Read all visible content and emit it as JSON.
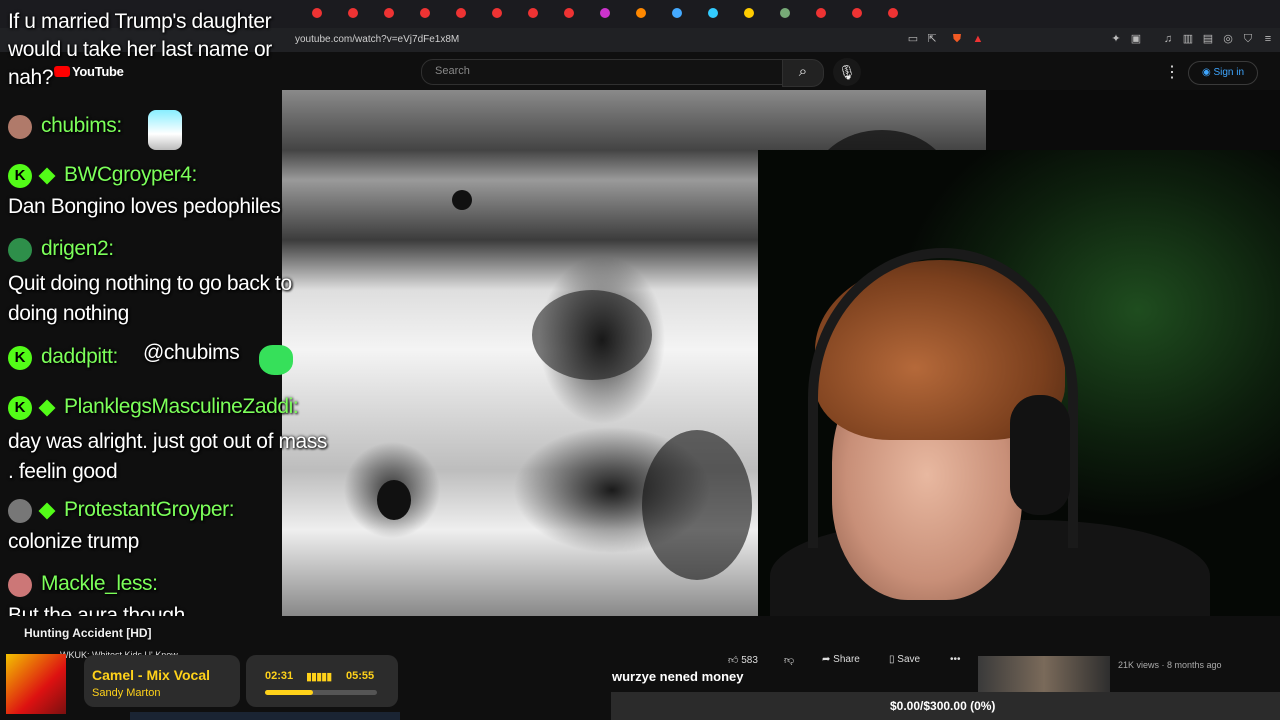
{
  "browser": {
    "url": "youtube.com/watch?v=eVj7dFe1x8M"
  },
  "youtube": {
    "logo_text": "YouTube",
    "search_placeholder": "Search",
    "signin_label": "Sign in"
  },
  "chat": {
    "question": "If u married Trump's daughter would u take her last name or nah?",
    "messages": [
      {
        "user": "chubims:",
        "text": ""
      },
      {
        "user": "BWCgroyper4:",
        "text": "Dan Bongino loves pedophiles"
      },
      {
        "user": "drigen2:",
        "text": "Quit doing nothing to go back to doing nothing"
      },
      {
        "user": "daddpitt:",
        "text": "@chubims"
      },
      {
        "user": "PlanklegsMasculineZaddi:",
        "text": "day was alright. just got out of mass . feelin good"
      },
      {
        "user": "ProtestantGroyper:",
        "text": "colonize trump"
      },
      {
        "user": "Mackle_less:",
        "text": "But the aura though"
      }
    ],
    "kick_badge": "K"
  },
  "video": {
    "title": "Hunting Accident [HD]",
    "subtitle_partial": "WKUK: Whitest Kids U' Know..."
  },
  "actions": {
    "likes": "583",
    "share_label": "Share",
    "save_label": "Save"
  },
  "recommended": {
    "meta": "21K views · 8 months ago"
  },
  "stream": {
    "caption": "wurzye nened money",
    "goal": "$0.00/$300.00 (0%)"
  },
  "music": {
    "song": "Camel - Mix Vocal",
    "artist": "Sandy Marton",
    "current_time": "02:31",
    "total_time": "05:55",
    "progress": 0.43
  },
  "colors": {
    "chat_username": "#7cff5a",
    "kick_green": "#53fc18",
    "music_yellow": "#ffd21a",
    "yt_link_blue": "#3ea6ff"
  }
}
